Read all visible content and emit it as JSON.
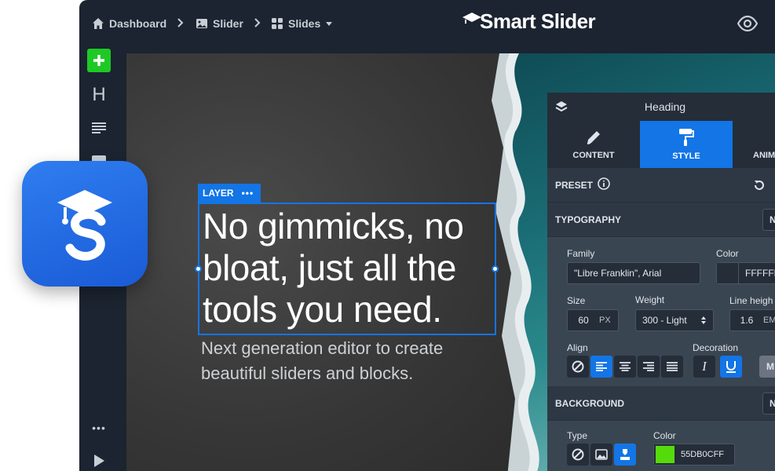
{
  "breadcrumb": {
    "dashboard": "Dashboard",
    "slider": "Slider",
    "slides": "Slides"
  },
  "brand": {
    "name": "Smart Slider"
  },
  "leftbar": {
    "heading_icon": "H",
    "more": "•••"
  },
  "layer": {
    "tag": "LAYER",
    "tag_more": "•••",
    "heading": "No gimmicks, no bloat, just all the tools you need.",
    "subheading": "Next generation editor to create beautiful sliders and blocks."
  },
  "panel": {
    "title": "Heading",
    "tabs": [
      {
        "label": "CONTENT"
      },
      {
        "label": "STYLE"
      },
      {
        "label": "ANIM"
      }
    ],
    "preset": "PRESET",
    "typography": "TYPOGRAPHY",
    "typography_toggle": "N",
    "family_label": "Family",
    "family_value": "\"Libre Franklin\", Arial",
    "color_label": "Color",
    "color_value": "FFFFFF",
    "size_label": "Size",
    "size_value": "60",
    "size_unit": "PX",
    "weight_label": "Weight",
    "weight_value": "300 - Light",
    "lineheight_label": "Line heigh",
    "lineheight_value": "1.6",
    "lineheight_unit": "EM",
    "align_label": "Align",
    "decoration_label": "Decoration",
    "decoration_extra": "M",
    "background": "BACKGROUND",
    "background_toggle": "N",
    "type_label": "Type",
    "bg_color_label": "Color",
    "bg_color_value": "55DB0CFF",
    "bg_swatch": "#55DB0C"
  },
  "colors": {
    "accent": "#1375e6",
    "add_button": "#1ec925"
  }
}
